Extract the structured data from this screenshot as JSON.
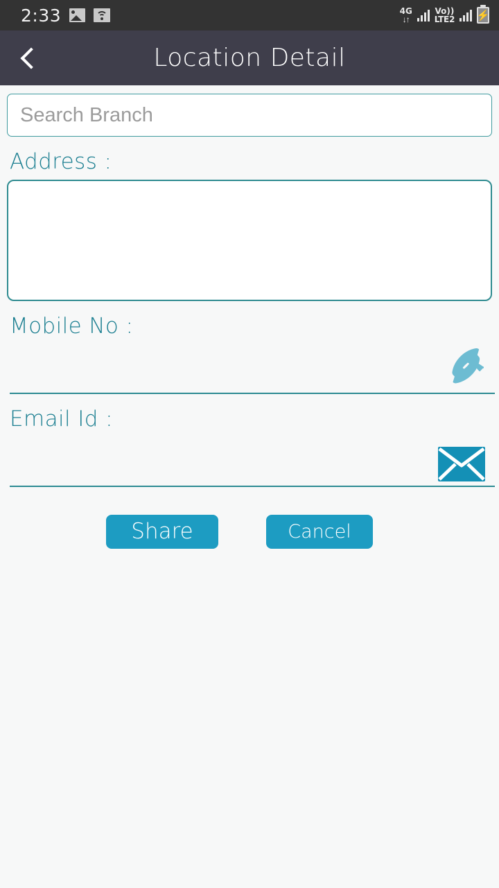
{
  "status_bar": {
    "time": "2:33",
    "icons": [
      "photo-icon",
      "wifi-icon"
    ],
    "network_label": "4G",
    "network_arrows": "↓↑",
    "volte_label": "Vo))",
    "volte_sub": "LTE2",
    "battery": "charging",
    "background": "#333333"
  },
  "app_bar": {
    "title": "Location Detail",
    "back_icon": "back-chevron-icon",
    "background": "#3f3e4b"
  },
  "form": {
    "search": {
      "placeholder": "Search Branch",
      "value": ""
    },
    "address": {
      "label": "Address :",
      "value": ""
    },
    "mobile": {
      "label": "Mobile No :",
      "value": "",
      "icon": "phone-icon"
    },
    "email": {
      "label": "Email Id :",
      "value": "",
      "icon": "envelope-icon"
    }
  },
  "actions": {
    "share_label": "Share",
    "cancel_label": "Cancel"
  },
  "colors": {
    "accent_teal": "#1c7f91",
    "button_blue": "#1d9cc2",
    "phone_icon": "#6dbcd2",
    "mail_icon": "#1490b6",
    "page_background": "#f7f8f8"
  }
}
